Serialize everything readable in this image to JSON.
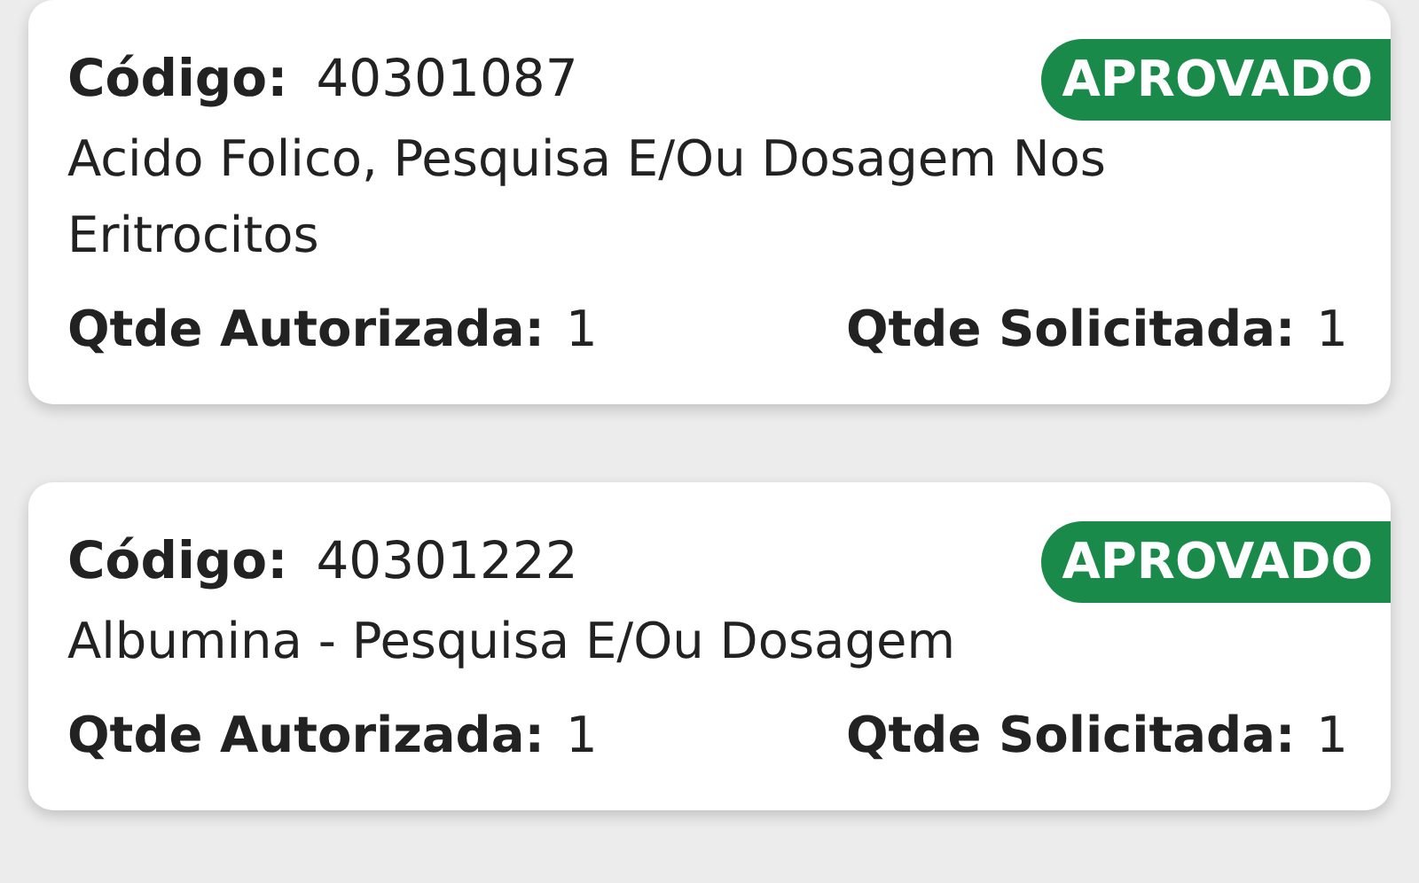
{
  "items": [
    {
      "code_label": "Código:",
      "code": "40301087",
      "status": "APROVADO",
      "description": "Acido Folico, Pesquisa E/Ou Dosagem Nos Eritrocitos",
      "authorized_label": "Qtde Autorizada:",
      "authorized": "1",
      "requested_label": "Qtde Solicitada:",
      "requested": "1"
    },
    {
      "code_label": "Código:",
      "code": "40301222",
      "status": "APROVADO",
      "description": "Albumina - Pesquisa E/Ou Dosagem",
      "authorized_label": "Qtde Autorizada:",
      "authorized": "1",
      "requested_label": "Qtde Solicitada:",
      "requested": "1"
    }
  ]
}
